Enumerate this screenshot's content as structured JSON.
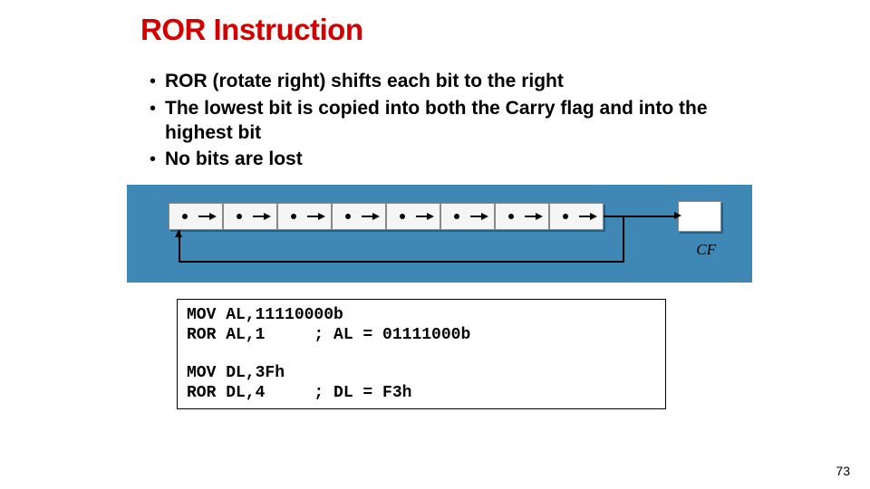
{
  "title": "ROR Instruction",
  "bullets": [
    "ROR (rotate right) shifts each bit to the right",
    "The lowest bit is copied into both the Carry flag and into the highest bit",
    "No bits are lost"
  ],
  "diagram": {
    "cf_label": "CF",
    "bit_count": 8
  },
  "code": {
    "line1": "MOV AL,11110000b",
    "line2": "ROR AL,1     ; AL = 01111000b",
    "line3": "MOV DL,3Fh",
    "line4": "ROR DL,4     ; DL = F3h"
  },
  "page_number": "73"
}
